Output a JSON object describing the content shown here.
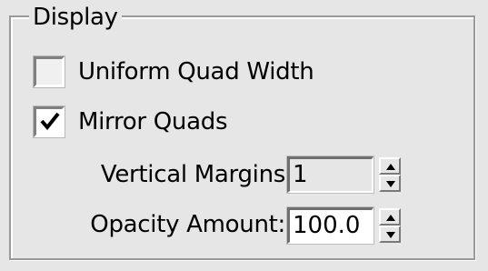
{
  "group": {
    "title": "Display"
  },
  "checkboxes": [
    {
      "label": "Uniform Quad Width",
      "checked": false
    },
    {
      "label": "Mirror Quads",
      "checked": true
    }
  ],
  "spinners": [
    {
      "label": "Vertical Margins",
      "value": "1",
      "enabled": false
    },
    {
      "label": "Opacity Amount:",
      "value": "100.0",
      "enabled": true
    }
  ],
  "icons": {
    "check": "checkmark-icon",
    "up": "spinner-up-arrow-icon",
    "down": "spinner-down-arrow-icon"
  }
}
